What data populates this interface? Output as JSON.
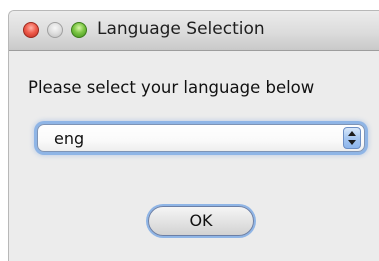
{
  "window": {
    "title": "Language Selection"
  },
  "dialog": {
    "prompt": "Please select your language below",
    "language_select": {
      "selected": "eng"
    },
    "ok_label": "OK"
  },
  "colors": {
    "close": "#f05e4e",
    "minimize": "#dedede",
    "zoom": "#7cc644",
    "focus_ring": "#8fb5e6"
  },
  "icons": {
    "close": "close-icon",
    "minimize": "minimize-icon",
    "zoom": "zoom-icon",
    "stepper": "up-down-arrows-icon"
  }
}
